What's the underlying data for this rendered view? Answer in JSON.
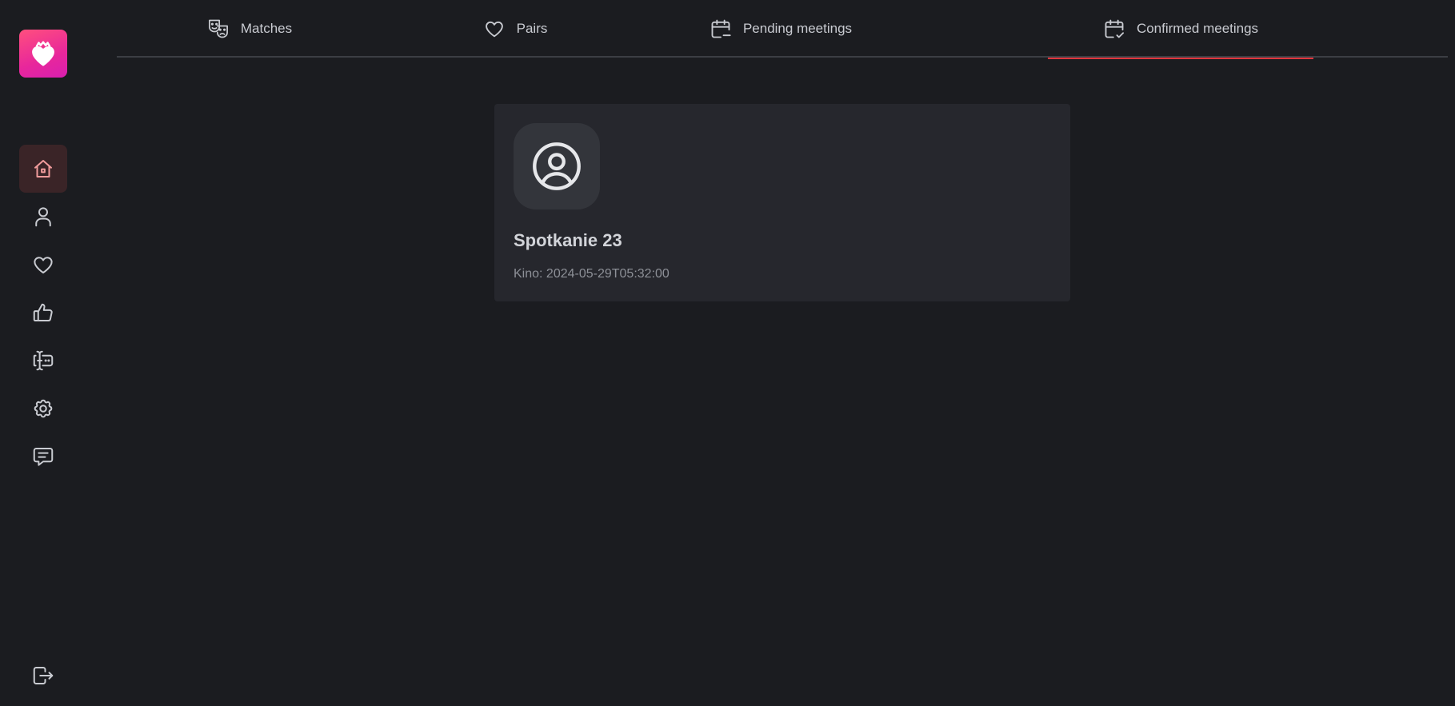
{
  "app": {
    "logo_icon": "heart-crown-icon",
    "brand_gradient": [
      "#ff4f7e",
      "#d91fb0"
    ]
  },
  "sidebar": {
    "items": [
      {
        "name": "home",
        "icon": "home-icon",
        "active": true
      },
      {
        "name": "profile",
        "icon": "user-icon",
        "active": false
      },
      {
        "name": "likes",
        "icon": "heart-icon",
        "active": false
      },
      {
        "name": "recommendations",
        "icon": "thumbs-up-icon",
        "active": false
      },
      {
        "name": "chats",
        "icon": "text-cursor-chat-icon",
        "active": false
      },
      {
        "name": "settings",
        "icon": "gear-icon",
        "active": false
      },
      {
        "name": "messages",
        "icon": "message-square-icon",
        "active": false
      }
    ],
    "logout_icon": "logout-icon"
  },
  "tabs": [
    {
      "label": "Matches",
      "icon": "theater-masks-icon",
      "active": false
    },
    {
      "label": "Pairs",
      "icon": "heart-icon",
      "active": false
    },
    {
      "label": "Pending meetings",
      "icon": "calendar-minus-icon",
      "active": false
    },
    {
      "label": "Confirmed meetings",
      "icon": "calendar-check-icon",
      "active": true
    }
  ],
  "meeting_card": {
    "avatar_icon": "user-circle-icon",
    "title": "Spotkanie 23",
    "subtitle": "Kino: 2024-05-29T05:32:00"
  },
  "colors": {
    "background": "#1b1c20",
    "card": "#26272d",
    "active_tab_underline": "#e0353d",
    "active_nav_bg": "#3a2427",
    "active_nav_icon": "#f29c9c"
  }
}
